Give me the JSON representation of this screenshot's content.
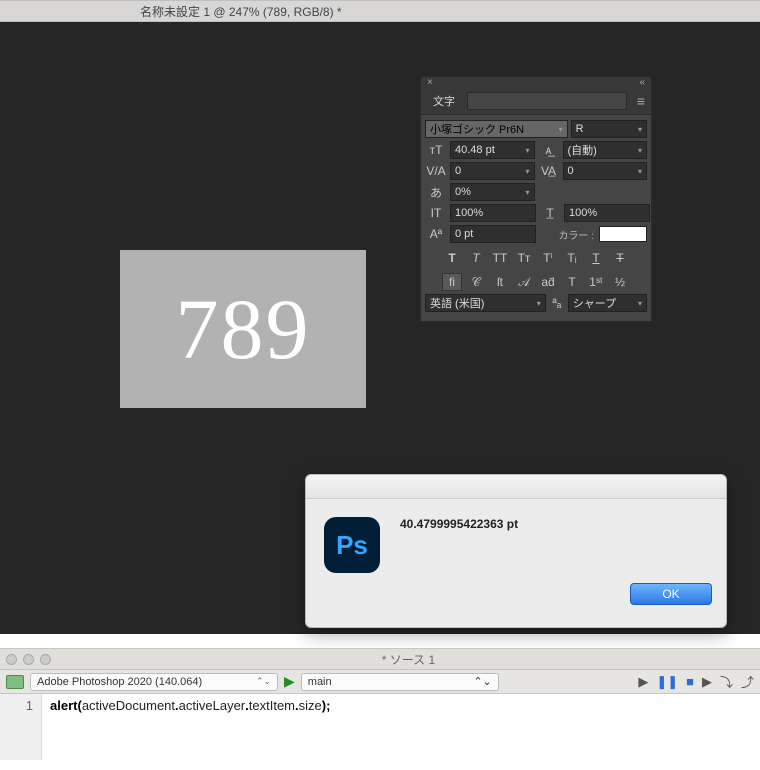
{
  "doc_title": "名称未設定 1 @ 247% (789, RGB/8) *",
  "canvas_text": "789",
  "char_panel": {
    "tab": "文字",
    "font_family": "小塚ゴシック Pr6N",
    "font_style": "R",
    "size": "40.48 pt",
    "leading": "(自動)",
    "va_metric": "0",
    "tracking": "0",
    "tsume": "0%",
    "vscale": "100%",
    "hscale": "100%",
    "baseline": "0 pt",
    "color_label": "カラー :",
    "lang": "英語 (米国)",
    "sharpen": "シャープ"
  },
  "alert": {
    "msg": "40.4799995422363 pt",
    "ok": "OK"
  },
  "estk": {
    "title": "* ソース 1",
    "target": "Adobe Photoshop 2020 (140.064)",
    "func": "main",
    "line_no": "1",
    "code_alert": "alert",
    "code_open": "(",
    "code_arg": "activeDocument",
    "code_dot1": ".",
    "code_p1": "activeLayer",
    "code_dot2": ".",
    "code_p2": "textItem",
    "code_dot3": ".",
    "code_p3": "size",
    "code_close": ");"
  }
}
